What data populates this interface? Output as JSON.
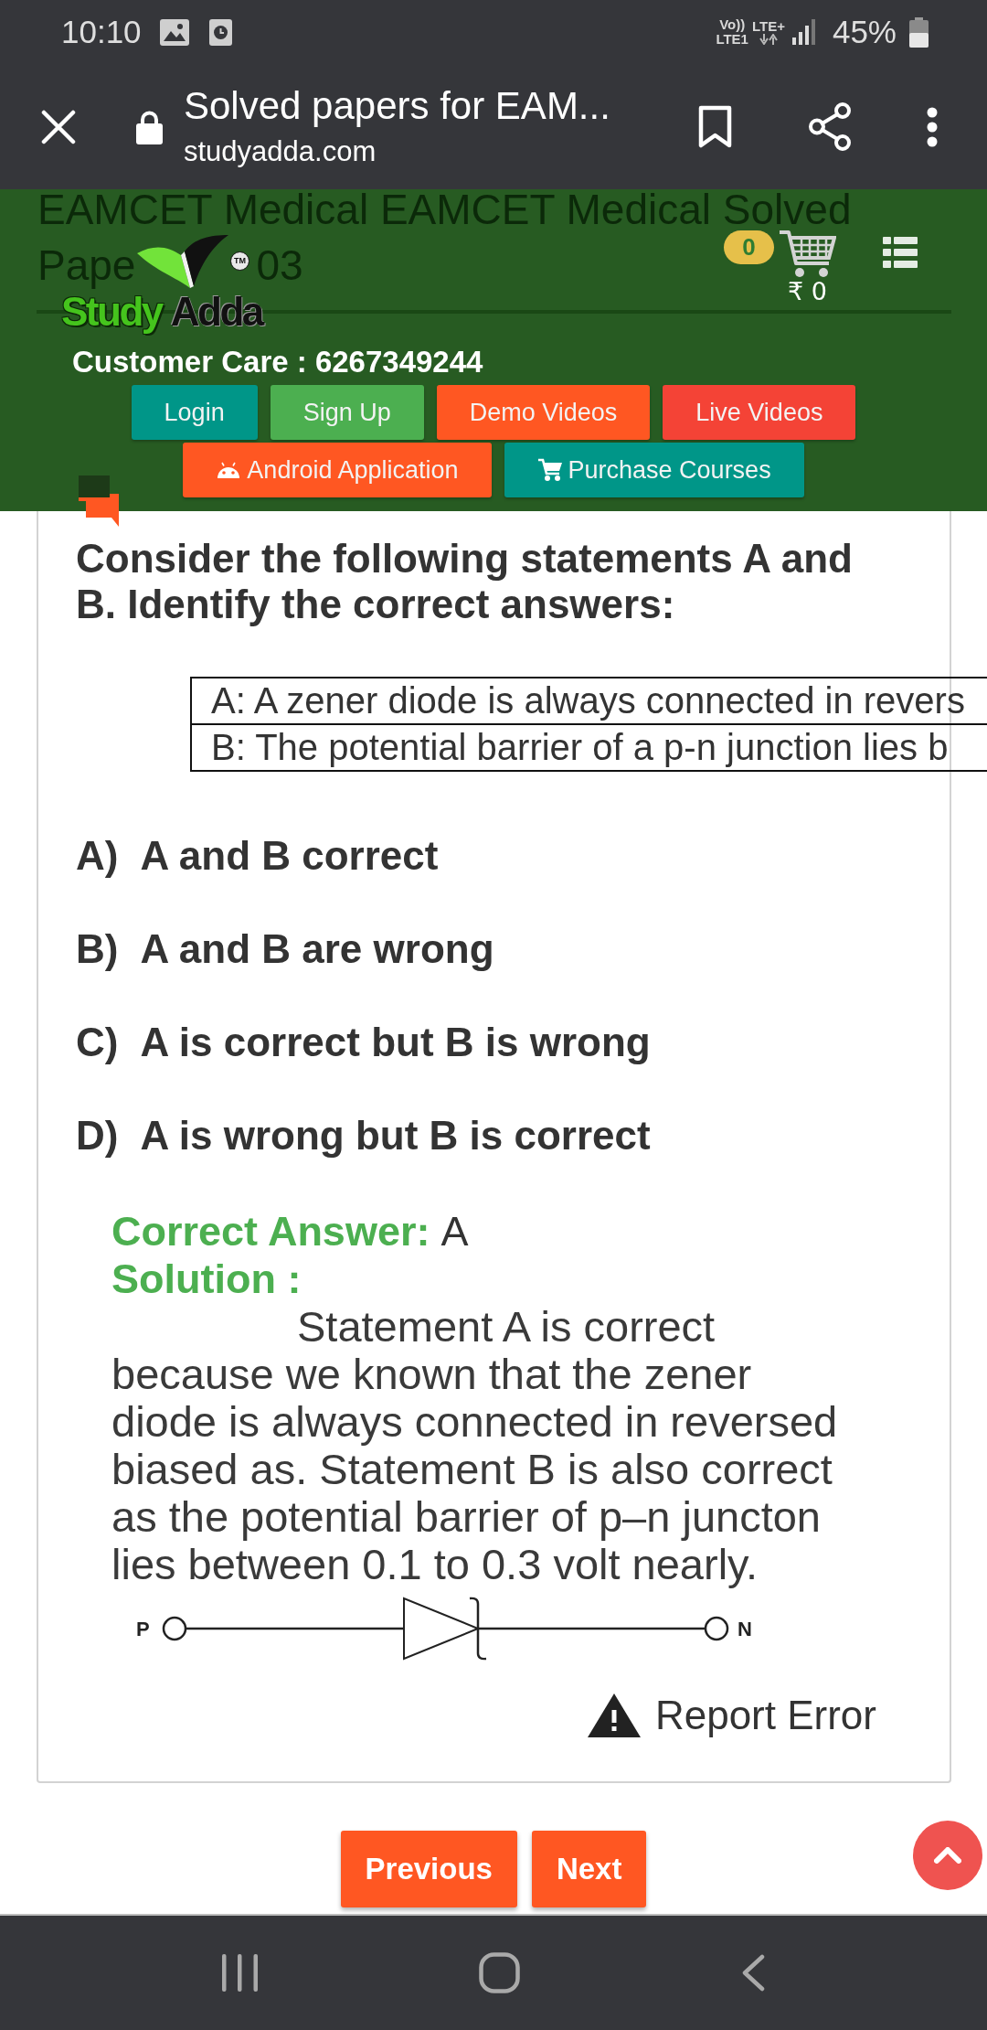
{
  "status_bar": {
    "time": "10:10",
    "volte": "Vo))",
    "network": "LTE+",
    "sim": "LTE1",
    "battery": "45%"
  },
  "browser_bar": {
    "title": "Solved papers for EAM...",
    "url": "studyadda.com"
  },
  "site_header": {
    "page_title_line_1": "EAMCET Medical EAMCET Medical Solved",
    "page_title_line_2_visible": [
      "Pape",
      "03"
    ],
    "logo": {
      "words": [
        "Study",
        "Adda"
      ],
      "trademark": "TM"
    },
    "cart": {
      "count": "0",
      "total": "₹ 0"
    },
    "customer_care": "Customer Care : 6267349244",
    "buttons": [
      {
        "label": "Login",
        "color": "#009688",
        "kind": "plain"
      },
      {
        "label": "Sign Up",
        "color": "#4caf50",
        "kind": "plain"
      },
      {
        "label": "Demo Videos",
        "color": "#ff5722",
        "kind": "plain"
      },
      {
        "label": "Live Videos",
        "color": "#f44336",
        "kind": "plain"
      },
      {
        "label": "Android Application",
        "color": "#ff5722",
        "kind": "app"
      },
      {
        "label": "Purchase Courses",
        "color": "#009688",
        "kind": "shop"
      }
    ]
  },
  "question": {
    "text": "Consider the following statements A and B. Identify the correct answers:",
    "statements": [
      "A: A zener diode is always connected in revers",
      "B: The potential barrier of a p-n junction lies b"
    ],
    "options": [
      {
        "letter": "A)",
        "text": "A and B correct"
      },
      {
        "letter": "B)",
        "text": "A and B are wrong"
      },
      {
        "letter": "C)",
        "text": "A is correct but B is wrong"
      },
      {
        "letter": "D)",
        "text": "A is wrong but B is correct"
      }
    ],
    "correct_answer": {
      "label": "Correct Answer:",
      "value": "A"
    },
    "solution": {
      "label": "Solution :",
      "text": "Statement A is correct because we known that the zener diode is always connected in reversed biased as. Statement B is also correct as the potential barrier of p–n juncton lies between 0.1 to 0.3 volt nearly."
    },
    "diagram": {
      "terminals": [
        "P",
        "N"
      ]
    },
    "report_link": "Report Error"
  },
  "pagination": [
    "Previous",
    "Next"
  ]
}
